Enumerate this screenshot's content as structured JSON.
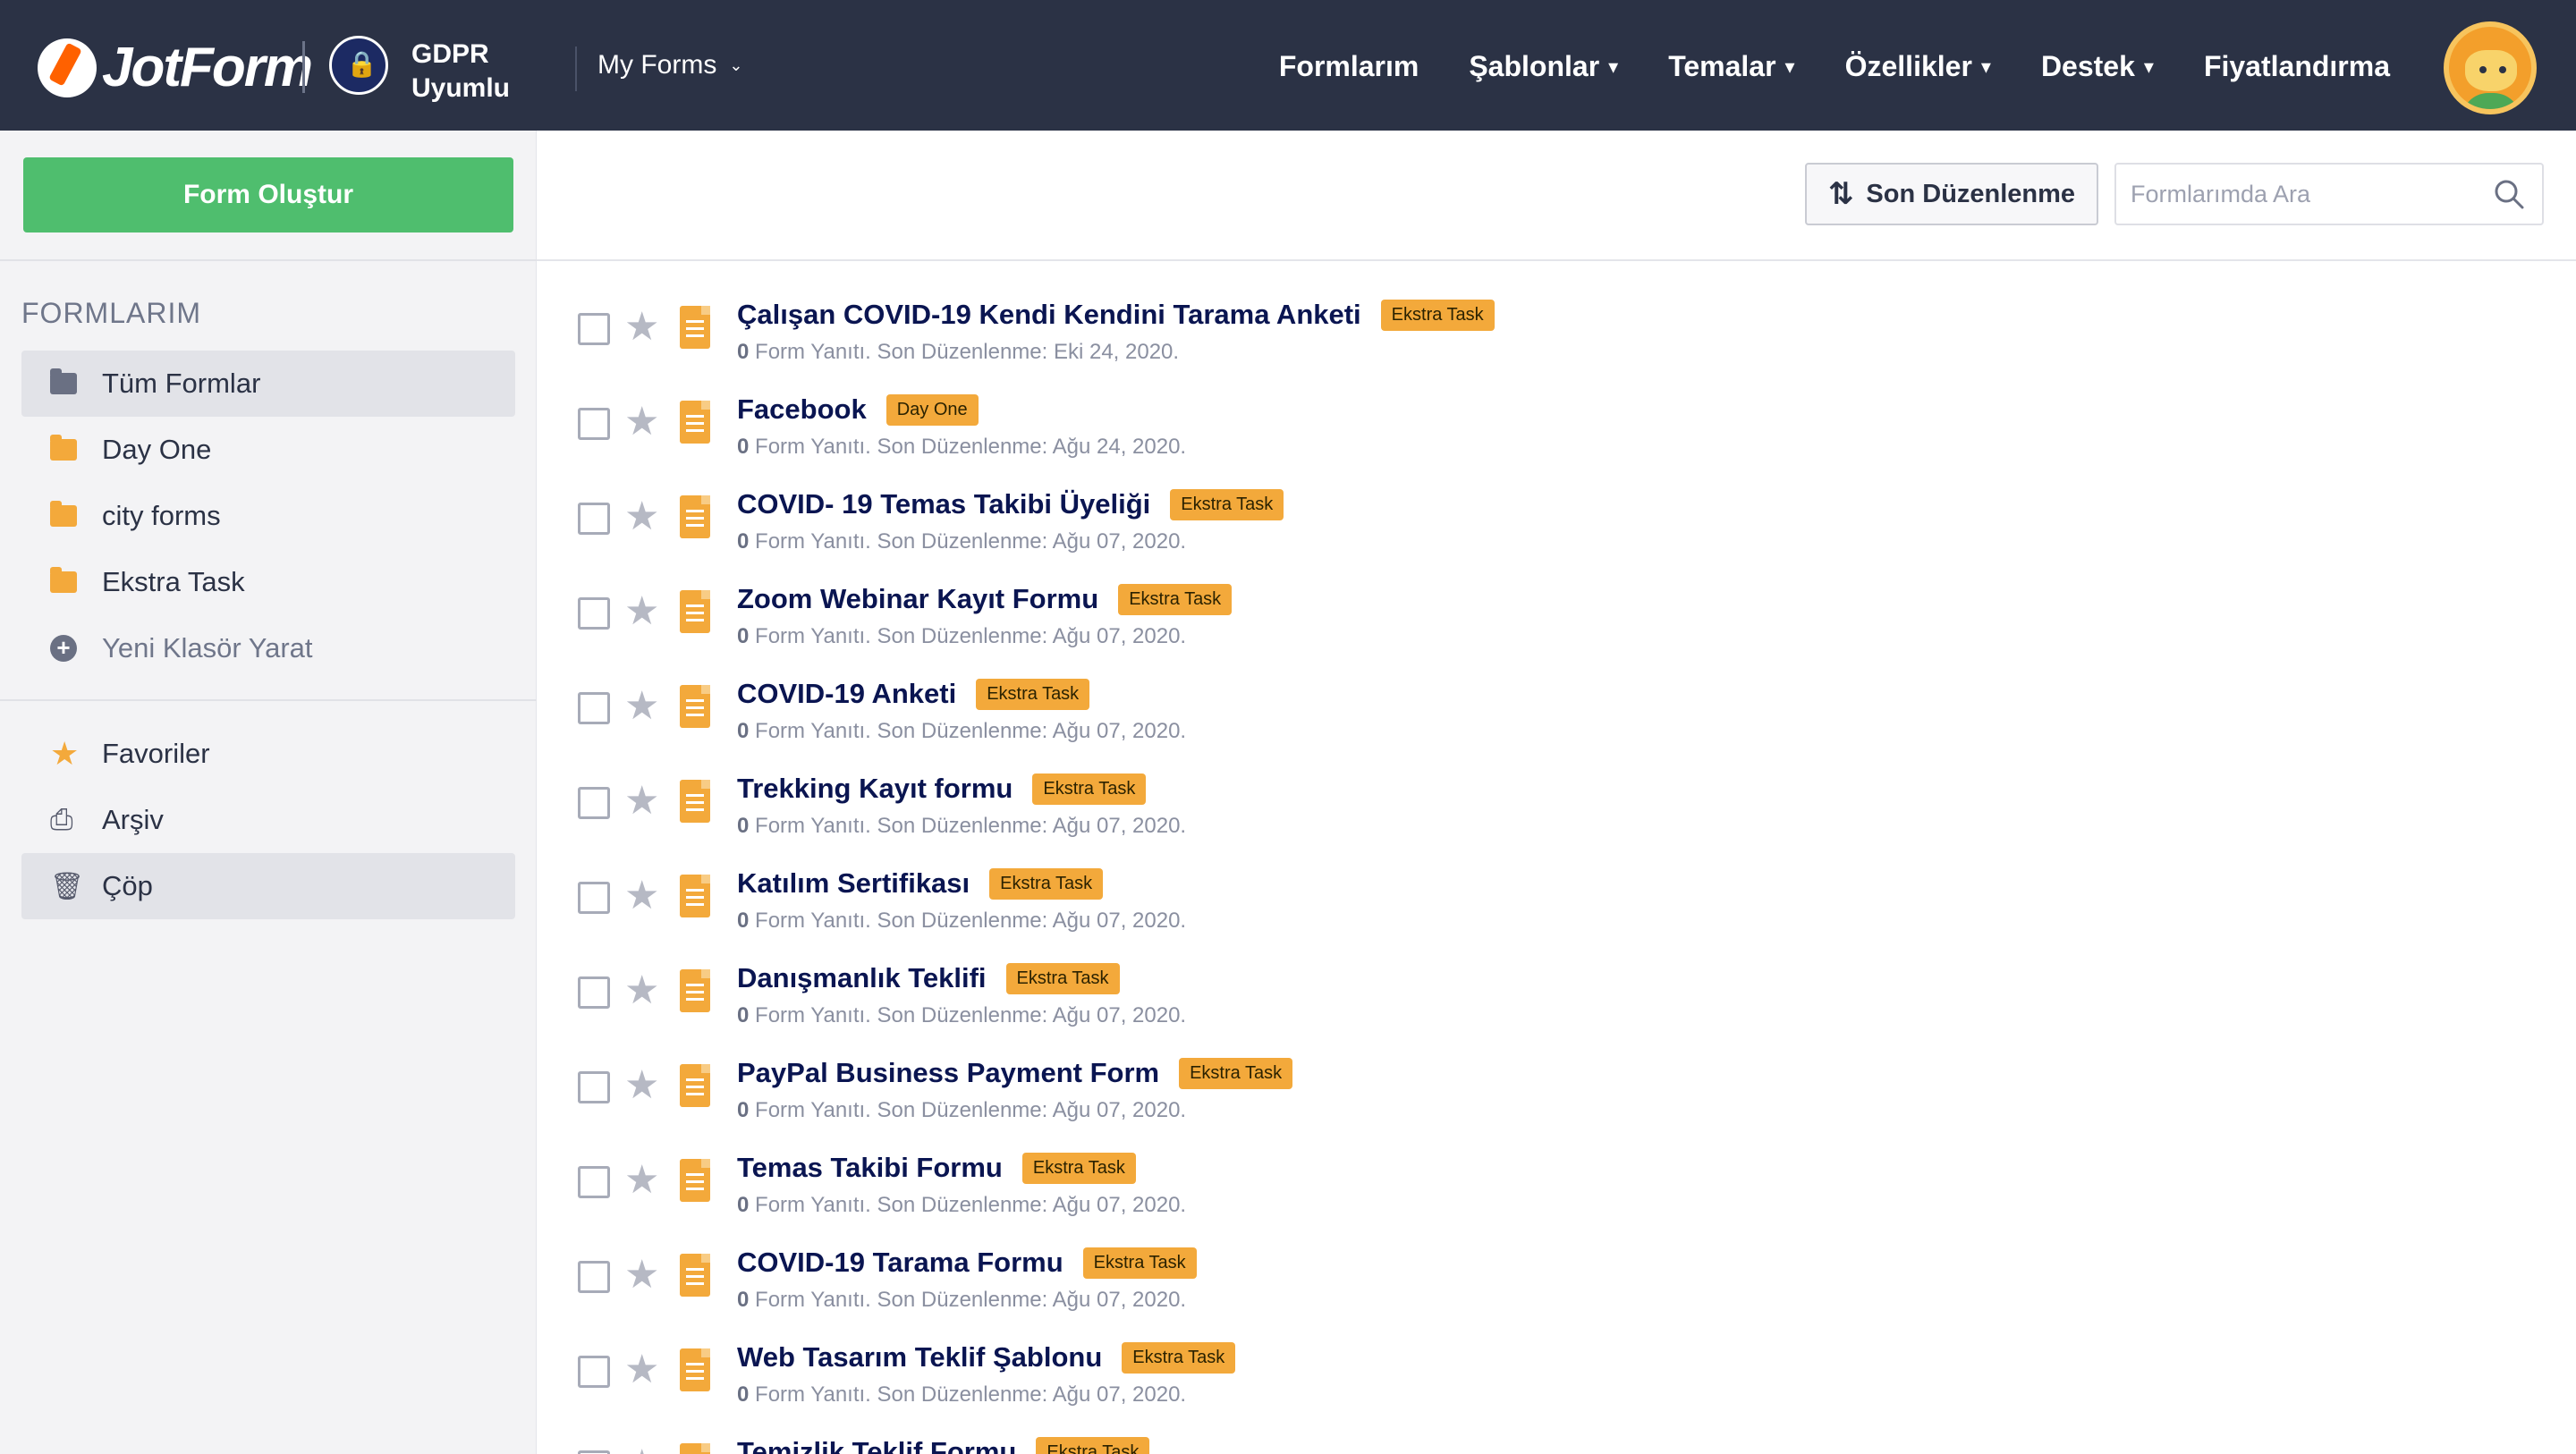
{
  "header": {
    "logo_text": "JotForm",
    "gdpr_line1": "GDPR",
    "gdpr_line2": "Uyumlu",
    "myforms_label": "My Forms",
    "nav": [
      {
        "label": "Formlarım",
        "has_caret": false
      },
      {
        "label": "Şablonlar",
        "has_caret": true
      },
      {
        "label": "Temalar",
        "has_caret": true
      },
      {
        "label": "Özellikler",
        "has_caret": true
      },
      {
        "label": "Destek",
        "has_caret": true
      },
      {
        "label": "Fiyatlandırma",
        "has_caret": false
      }
    ]
  },
  "sidebar": {
    "create_label": "Form Oluştur",
    "heading": "FORMLARIM",
    "folders": [
      {
        "label": "Tüm Formlar",
        "icon": "folder-icon",
        "active": true
      },
      {
        "label": "Day One",
        "icon": "folder-icon",
        "active": false
      },
      {
        "label": "city forms",
        "icon": "folder-icon",
        "active": false
      },
      {
        "label": "Ekstra Task",
        "icon": "folder-icon",
        "active": false
      },
      {
        "label": "Yeni Klasör Yarat",
        "icon": "plus-circle-icon",
        "active": false
      }
    ],
    "bottom_items": [
      {
        "label": "Favoriler",
        "icon": "star-icon",
        "active": false
      },
      {
        "label": "Arşiv",
        "icon": "inbox-icon",
        "active": false
      },
      {
        "label": "Çöp",
        "icon": "trash-icon",
        "active": true
      }
    ]
  },
  "toolbar": {
    "sort_label": "Son Düzenlenme",
    "search_placeholder": "Formlarımda Ara"
  },
  "forms": [
    {
      "title": "Çalışan COVID-19 Kendi Kendini Tarama Anketi",
      "tag": "Ekstra Task",
      "responses": "0",
      "meta": " Form Yanıtı. Son Düzenlenme: Eki 24, 2020."
    },
    {
      "title": "Facebook",
      "tag": "Day One",
      "responses": "0",
      "meta": " Form Yanıtı. Son Düzenlenme: Ağu 24, 2020."
    },
    {
      "title": "COVID- 19 Temas Takibi Üyeliği",
      "tag": "Ekstra Task",
      "responses": "0",
      "meta": " Form Yanıtı. Son Düzenlenme: Ağu 07, 2020."
    },
    {
      "title": "Zoom Webinar Kayıt Formu",
      "tag": "Ekstra Task",
      "responses": "0",
      "meta": " Form Yanıtı. Son Düzenlenme: Ağu 07, 2020."
    },
    {
      "title": "COVID-19 Anketi",
      "tag": "Ekstra Task",
      "responses": "0",
      "meta": " Form Yanıtı. Son Düzenlenme: Ağu 07, 2020."
    },
    {
      "title": "Trekking Kayıt formu",
      "tag": "Ekstra Task",
      "responses": "0",
      "meta": " Form Yanıtı. Son Düzenlenme: Ağu 07, 2020."
    },
    {
      "title": "Katılım Sertifikası",
      "tag": "Ekstra Task",
      "responses": "0",
      "meta": " Form Yanıtı. Son Düzenlenme: Ağu 07, 2020."
    },
    {
      "title": "Danışmanlık Teklifi",
      "tag": "Ekstra Task",
      "responses": "0",
      "meta": " Form Yanıtı. Son Düzenlenme: Ağu 07, 2020."
    },
    {
      "title": "PayPal Business Payment Form",
      "tag": "Ekstra Task",
      "responses": "0",
      "meta": " Form Yanıtı. Son Düzenlenme: Ağu 07, 2020."
    },
    {
      "title": "Temas Takibi Formu",
      "tag": "Ekstra Task",
      "responses": "0",
      "meta": " Form Yanıtı. Son Düzenlenme: Ağu 07, 2020."
    },
    {
      "title": "COVID-19 Tarama Formu",
      "tag": "Ekstra Task",
      "responses": "0",
      "meta": " Form Yanıtı. Son Düzenlenme: Ağu 07, 2020."
    },
    {
      "title": "Web Tasarım Teklif Şablonu",
      "tag": "Ekstra Task",
      "responses": "0",
      "meta": " Form Yanıtı. Son Düzenlenme: Ağu 07, 2020."
    },
    {
      "title": "Temizlik Teklif Formu",
      "tag": "Ekstra Task",
      "responses": "",
      "meta": ""
    }
  ],
  "colors": {
    "topbar": "#2b3245",
    "create_button": "#4fbe6e",
    "tag": "#f3a93b",
    "folder": "#f3a93b"
  }
}
